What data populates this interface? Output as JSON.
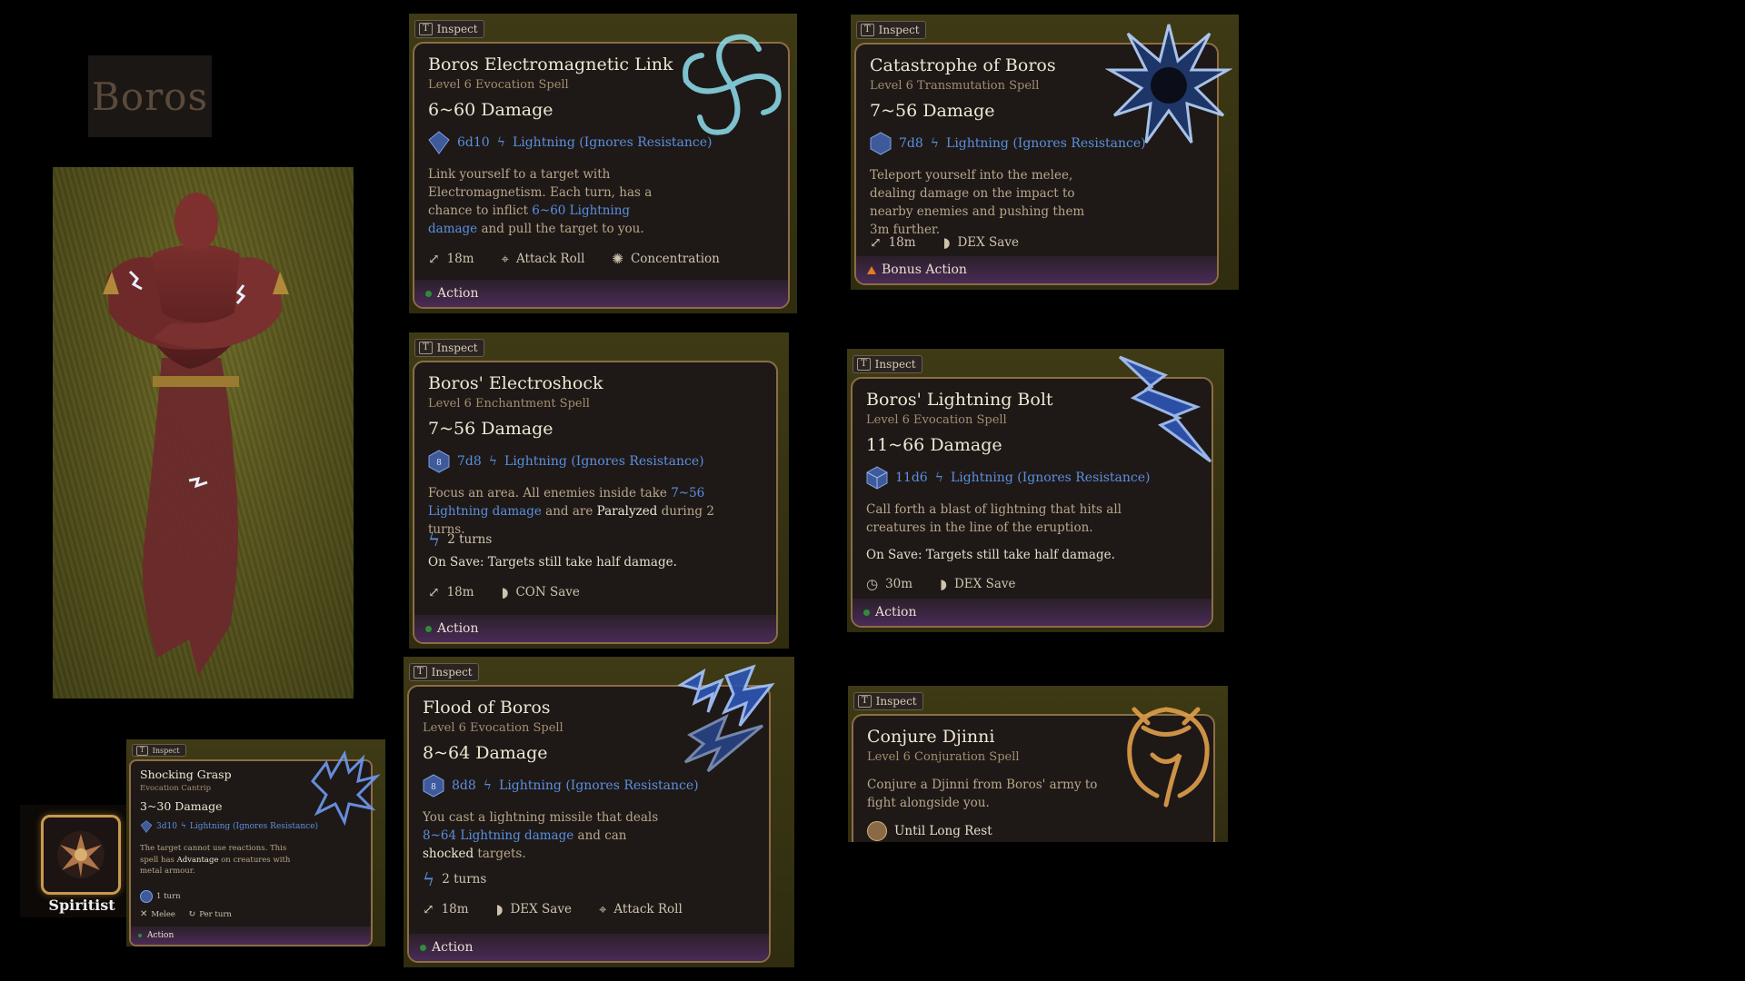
{
  "nameplate": "Boros",
  "spiritist": {
    "label": "Spiritist"
  },
  "inspect": {
    "key": "T",
    "label": "Inspect"
  },
  "cards": {
    "electro_link": {
      "title": "Boros Electromagnetic Link",
      "subtitle": "Level 6 Evocation Spell",
      "damage": "6~60 Damage",
      "dice": "6d10",
      "dmg_type": "Lightning (Ignores Resistance)",
      "desc_1": "Link yourself to a target with Electromagnetism. Each turn, has a chance to inflict ",
      "desc_blue": "6~60 Lightning damage",
      "desc_2": " and pull the target to you.",
      "range": "18m",
      "stat2": "Attack Roll",
      "stat3": "Concentration",
      "action": "Action"
    },
    "catastrophe": {
      "title": "Catastrophe of Boros",
      "subtitle": "Level 6 Transmutation Spell",
      "damage": "7~56 Damage",
      "dice": "7d8",
      "dmg_type": "Lightning (Ignores Resistance)",
      "desc": "Teleport yourself into the melee, dealing damage on the impact to nearby enemies and pushing them 3m further.",
      "range": "18m",
      "save": "DEX Save",
      "action": "Bonus Action"
    },
    "electroshock": {
      "title": "Boros' Electroshock",
      "subtitle": "Level 6 Enchantment Spell",
      "damage": "7~56 Damage",
      "dice": "7d8",
      "die_face": "8",
      "dmg_type": "Lightning (Ignores Resistance)",
      "desc_1": "Focus an area. All enemies inside take ",
      "desc_blue": "7~56 Lightning damage",
      "desc_2": " and are ",
      "desc_white": "Paralyzed",
      "desc_3": " during 2 turns.",
      "turns": "2 turns",
      "on_save": "On Save: Targets still take half damage.",
      "range": "18m",
      "save": "CON Save",
      "action": "Action"
    },
    "lightning_bolt": {
      "title": "Boros' Lightning Bolt",
      "subtitle": "Level 6 Evocation Spell",
      "damage": "11~66 Damage",
      "dice": "11d6",
      "dmg_type": "Lightning (Ignores Resistance)",
      "desc": "Call forth a blast of lightning that hits all creatures in the line of the eruption.",
      "on_save": "On Save: Targets still take half damage.",
      "range": "30m",
      "save": "DEX Save",
      "action": "Action"
    },
    "flood": {
      "title": "Flood of Boros",
      "subtitle": "Level 6 Evocation Spell",
      "damage": "8~64 Damage",
      "dice": "8d8",
      "die_face": "8",
      "dmg_type": "Lightning (Ignores Resistance)",
      "desc_1": "You cast a lightning missile that deals ",
      "desc_blue": "8~64 Lightning damage",
      "desc_2": " and can ",
      "desc_white": "shocked",
      "desc_3": " targets.",
      "turns": "2 turns",
      "range": "18m",
      "save": "DEX Save",
      "stat3": "Attack Roll",
      "action": "Action"
    },
    "djinni": {
      "title": "Conjure Djinni",
      "subtitle": "Level 6 Conjuration Spell",
      "desc": "Conjure a Djinni from Boros' army to fight alongside you.",
      "duration": "Until Long Rest"
    },
    "shocking_grasp": {
      "title": "Shocking Grasp",
      "subtitle": "Evocation Cantrip",
      "damage": "3~30 Damage",
      "dice": "3d10",
      "dmg_type": "Lightning (Ignores Resistance)",
      "desc_1": "The target cannot use reactions. This spell has ",
      "desc_white": "Advantage",
      "desc_2": " on creatures with metal armour.",
      "turns": "1 turn",
      "melee": "Melee",
      "per_turn": "Per turn",
      "action": "Action"
    }
  },
  "colors": {
    "lightning_blue": "#5b8fe0",
    "frame_gold": "#8d6d45",
    "action_green": "#2f8d3a",
    "bonus_orange": "#e37b24"
  }
}
